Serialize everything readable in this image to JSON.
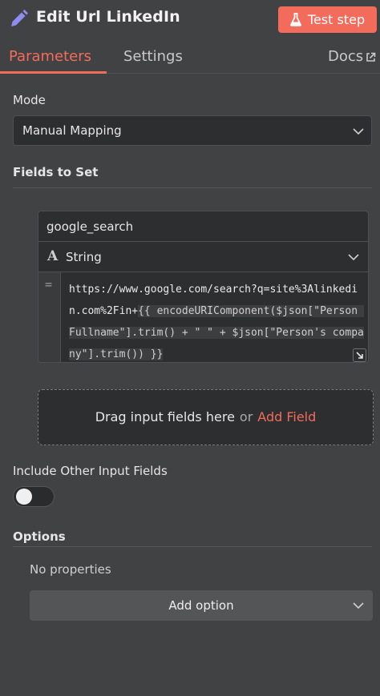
{
  "header": {
    "title": "Edit Url LinkedIn",
    "test_button_label": "Test step",
    "pencil_icon": "pencil-icon",
    "flask_icon": "flask-icon"
  },
  "tabs": {
    "parameters": "Parameters",
    "settings": "Settings",
    "docs": "Docs"
  },
  "mode": {
    "label": "Mode",
    "value": "Manual Mapping"
  },
  "fields_to_set": {
    "label": "Fields to Set",
    "field": {
      "name": "google_search",
      "type_icon_glyph": "A",
      "type": "String",
      "equals_sign": "=",
      "value_static": "https://www.google.com/search?q=site%3Alinkedin.com%2Fin+",
      "value_expression": "{{ encodeURIComponent($json[\"Person Fullname\"].trim() + \" \" + $json[\"Person's company\"].trim()) }}"
    },
    "dropzone": {
      "text": "Drag input fields here",
      "or": "or",
      "add_field": "Add Field"
    }
  },
  "include_other": {
    "label": "Include Other Input Fields",
    "enabled": false
  },
  "options": {
    "label": "Options",
    "empty_text": "No properties",
    "add_option_label": "Add option"
  },
  "colors": {
    "accent": "#f36b5b",
    "background": "#414244",
    "input_background": "#2d2e30"
  }
}
